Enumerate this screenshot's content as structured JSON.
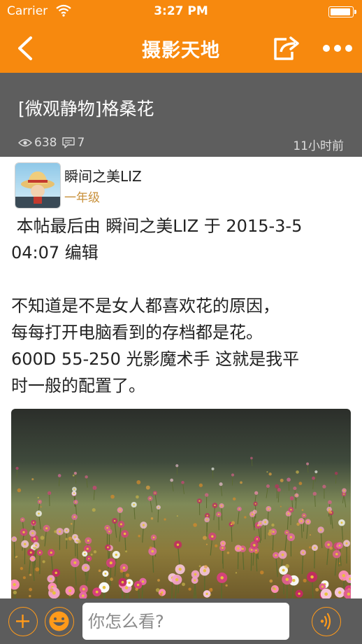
{
  "status_bar": {
    "carrier": "Carrier",
    "time": "3:27 PM",
    "battery_level": 0.95
  },
  "nav": {
    "title": "摄影天地"
  },
  "post": {
    "title": "[微观静物]格桑花",
    "views": "638",
    "comments": "7",
    "time_ago": "11小时前"
  },
  "author": {
    "name": "瞬间之美LIZ",
    "level": "一年级"
  },
  "content": {
    "edit_note_line1": " 本帖最后由 瞬间之美LIZ 于 2015-3-5",
    "edit_note_line2": "04:07 编辑",
    "para1_line1": "不知道是不是女人都喜欢花的原因，",
    "para1_line2": "每每打开电脑看到的存档都是花。",
    "para2_line1": "600D 55-250 光影魔术手 这就是我平",
    "para2_line2": "时一般的配置了。"
  },
  "bottom_bar": {
    "input_placeholder": "你怎么看?"
  },
  "colors": {
    "accent": "#f7890e",
    "header_bg": "#5e5e5e",
    "bottom_bar_bg": "#5c5c5c",
    "level_text": "#c8903a"
  }
}
